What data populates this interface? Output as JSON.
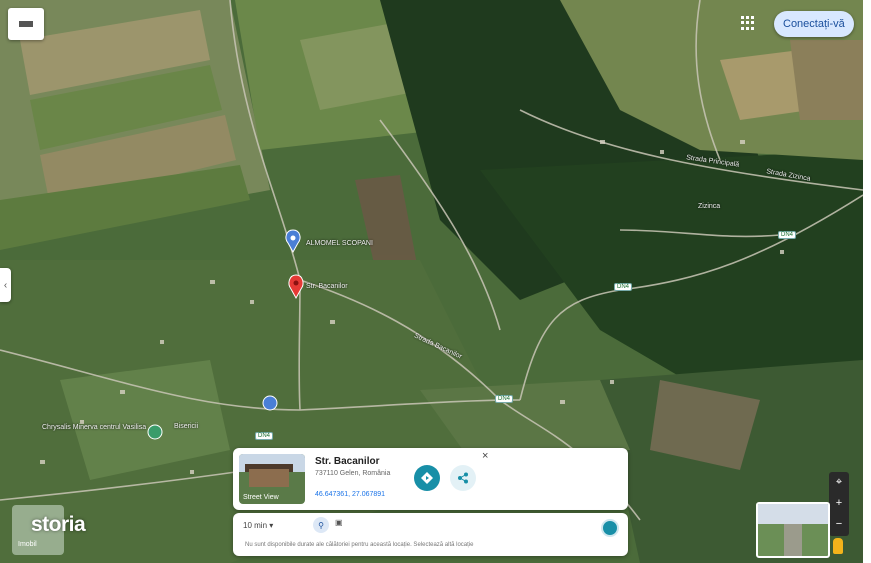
{
  "map": {
    "signin_label": "Conectați-vă",
    "side_tab_icon": "‹",
    "layers_icon": "layers-icon",
    "grid_icon": "apps-grid-icon",
    "labels": {
      "zizinca": "Zizinca",
      "saved_place": "ALMOMEL SCOPANI",
      "pin_label": "Str. Bacanilor",
      "church": "Chrysalis Minerva centrul Vasilisa",
      "bisericii": "Bisericii",
      "str_bacanilor_road": "Strada Bacanilor",
      "dn_road": "Strada Zizinca",
      "valea_road": "Strada Principală",
      "tag1": "DN4",
      "tag2": "DN4",
      "tag3": "DN4",
      "tag4": "DN4"
    },
    "colors": {
      "pin_red": "#e53935",
      "saved_blue": "#4a7fd6"
    }
  },
  "place_card": {
    "title": "Str. Bacanilor",
    "address": "737110 Gelen, România",
    "coordinates": "46.647361, 27.067891",
    "street_view_label": "Street View",
    "close_label": "×",
    "directions_icon": "directions-icon",
    "share_icon": "share-icon"
  },
  "route_card": {
    "time_select": "10 min ▾",
    "walk_icon": "walk-icon",
    "drive_icon": "car-icon",
    "message": "Nu sunt disponibile durate ale călătoriei pentru această locație. Selectează altă locație"
  },
  "zoom": {
    "in": "+",
    "out": "−",
    "locate": "⌖"
  },
  "watermark": {
    "logo": "storia",
    "sub": "Imobil"
  }
}
